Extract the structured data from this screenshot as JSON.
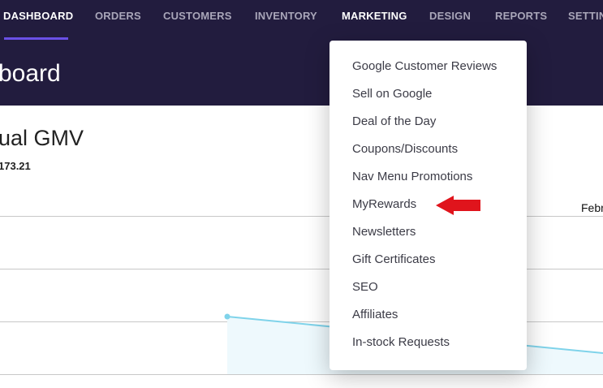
{
  "nav": {
    "items": [
      {
        "label": "DASHBOARD",
        "active": true
      },
      {
        "label": "ORDERS"
      },
      {
        "label": "CUSTOMERS"
      },
      {
        "label": "INVENTORY"
      },
      {
        "label": "MARKETING",
        "active": true
      },
      {
        "label": "DESIGN"
      },
      {
        "label": "REPORTS"
      },
      {
        "label": "SETTIN"
      }
    ]
  },
  "page": {
    "title": "board",
    "card_title": "ual GMV",
    "card_value": "173.21",
    "axis_label": "Febr"
  },
  "marketing_menu": {
    "items": [
      "Google Customer Reviews",
      "Sell on Google",
      "Deal of the Day",
      "Coupons/Discounts",
      "Nav Menu Promotions",
      "MyRewards",
      "Newsletters",
      "Gift Certificates",
      "SEO",
      "Affiliates",
      "In-stock Requests"
    ],
    "highlighted": "MyRewards"
  },
  "colors": {
    "header": "#221c3e",
    "accent": "#6a50e6",
    "line": "#7fd3ea",
    "arrow": "#e0141c"
  }
}
